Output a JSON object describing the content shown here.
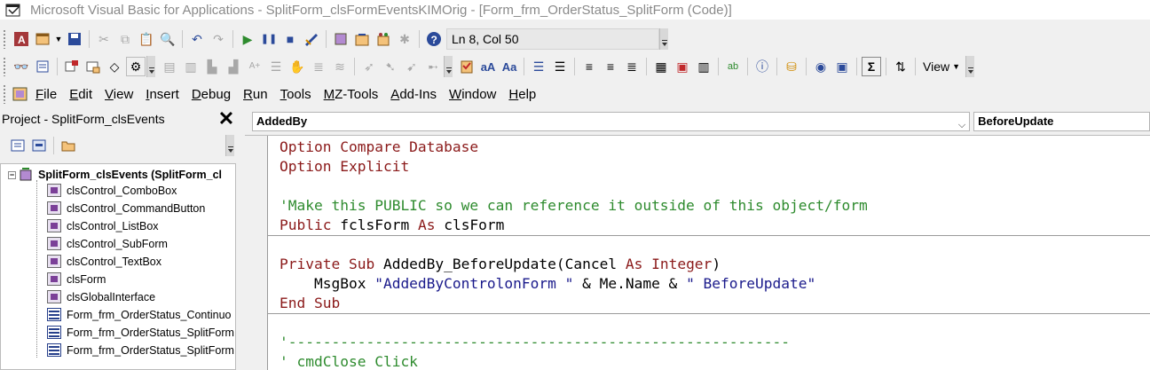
{
  "window": {
    "title": "Microsoft Visual Basic for Applications - SplitForm_clsFormEventsKIMOrig - [Form_frm_OrderStatus_SplitForm (Code)]"
  },
  "toolbar1": {
    "position_label": "Ln 8, Col 50",
    "buttons": [
      "access-icon",
      "insert-module-icon",
      "save-icon",
      "cut-icon",
      "copy-icon",
      "paste-icon",
      "find-icon",
      "undo-icon",
      "redo-icon",
      "run-icon",
      "break-icon",
      "reset-icon",
      "design-mode-icon",
      "project-explorer-icon",
      "properties-icon",
      "object-browser-icon",
      "toolbox-icon",
      "help-icon"
    ]
  },
  "toolbar2": {
    "view_label": "View"
  },
  "menu": {
    "items": [
      {
        "mnemonic": "F",
        "rest": "ile"
      },
      {
        "mnemonic": "E",
        "rest": "dit"
      },
      {
        "mnemonic": "V",
        "rest": "iew"
      },
      {
        "mnemonic": "I",
        "rest": "nsert"
      },
      {
        "mnemonic": "D",
        "rest": "ebug"
      },
      {
        "mnemonic": "R",
        "rest": "un"
      },
      {
        "mnemonic": "T",
        "rest": "ools"
      },
      {
        "mnemonic": "M",
        "rest": "Z-Tools"
      },
      {
        "mnemonic": "A",
        "rest": "dd-Ins"
      },
      {
        "mnemonic": "W",
        "rest": "indow"
      },
      {
        "mnemonic": "H",
        "rest": "elp"
      }
    ]
  },
  "project": {
    "title": "Project - SplitForm_clsEvents",
    "close_glyph": "✕",
    "root_label": "SplitForm_clsEvents (SplitForm_cl",
    "items": [
      {
        "label": "clsControl_ComboBox",
        "icon": "class-module-icon"
      },
      {
        "label": "clsControl_CommandButton",
        "icon": "class-module-icon"
      },
      {
        "label": "clsControl_ListBox",
        "icon": "class-module-icon"
      },
      {
        "label": "clsControl_SubForm",
        "icon": "class-module-icon"
      },
      {
        "label": "clsControl_TextBox",
        "icon": "class-module-icon"
      },
      {
        "label": "clsForm",
        "icon": "class-module-icon"
      },
      {
        "label": "clsGlobalInterface",
        "icon": "class-module-icon"
      },
      {
        "label": "Form_frm_OrderStatus_Continuo",
        "icon": "form-module-icon"
      },
      {
        "label": "Form_frm_OrderStatus_SplitForm",
        "icon": "form-module-icon"
      },
      {
        "label": "Form_frm_OrderStatus_SplitForm",
        "icon": "form-module-icon"
      }
    ]
  },
  "code": {
    "object_combo": "AddedBy",
    "procedure_combo": "BeforeUpdate",
    "lines": {
      "l1": {
        "kw1": "Option Compare Database"
      },
      "l2": {
        "kw1": "Option Explicit"
      },
      "l4": {
        "cm": "'Make this PUBLIC so we can reference it outside of this object/form"
      },
      "l5": {
        "kw1": "Public",
        "id1": " fclsForm ",
        "kw2": "As",
        "id2": " clsForm"
      },
      "l7": {
        "kw1": "Private Sub",
        "id1": " AddedBy_BeforeUpdate(Cancel ",
        "kw2": "As Integer",
        "id2": ")"
      },
      "l8": {
        "id1": "    MsgBox ",
        "st1": "\"AddedByControlonForm \"",
        "id2": " & Me.Name & ",
        "st2": "\" BeforeUpdate\""
      },
      "l9": {
        "kw1": "End Sub"
      },
      "l11": {
        "cm": "'----------------------------------------------------------"
      },
      "l12": {
        "cm": "' cmdClose Click"
      }
    }
  },
  "colors": {
    "keyword": "#8b1a1a",
    "comment": "#2e8b2e",
    "background": "#f0f0f0"
  }
}
